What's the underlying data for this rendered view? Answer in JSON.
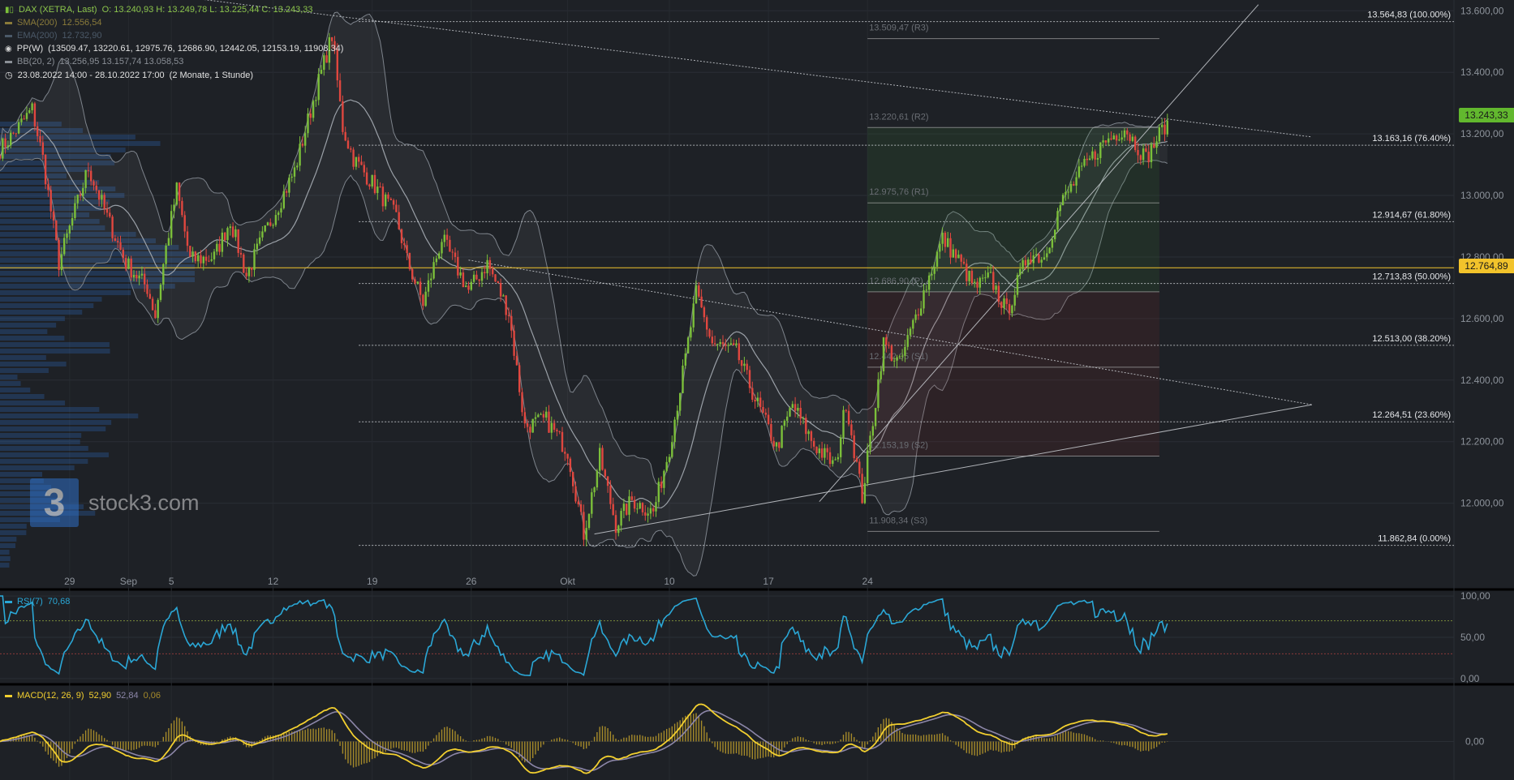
{
  "header": {
    "title": "DAX (XETRA, Last)",
    "ohlc": "O: 13.240,93  H: 13.249,78  L: 13.225,44  C: 13.243,33",
    "sma_label": "SMA(200)",
    "sma_value": "12.556,54",
    "ema_label": "EMA(200)",
    "ema_value": "12.732,90",
    "pp_label": "PP(W)",
    "pp_values": "(13509.47, 13220.61, 12975.76, 12686.90, 12442.05, 12153.19, 11908.34)",
    "bb_label": "BB(20, 2)",
    "bb_values": "13.256,95  13.157,74  13.058,53",
    "range_label": "23.08.2022 14:00 - 28.10.2022 17:00",
    "range_span": "(2 Monate, 1 Stunde)"
  },
  "logo": {
    "mark": "3",
    "text": "stock3.com"
  },
  "colors": {
    "background": "#1e2126",
    "up": "#7bbf3a",
    "down": "#e0473f",
    "price_tag": "#62b82e",
    "level_tag": "#f2c32b",
    "rsi": "#2aa7d6",
    "macd": "#f2cf2f",
    "signal": "#8c86a8",
    "histogram": "#a58a2a"
  },
  "price_tags": {
    "last": "13.243,33",
    "level": "12.764,89"
  },
  "chart_data": [
    {
      "type": "candlestick",
      "title": "DAX (XETRA, Last)",
      "x_ticks": [
        "29",
        "Sep",
        "5",
        "12",
        "19",
        "26",
        "Okt",
        "10",
        "17",
        "24"
      ],
      "y_ticks": [
        "13.600,00",
        "13.400,00",
        "13.200,00",
        "13.000,00",
        "12.800,00",
        "12.600,00",
        "12.400,00",
        "12.200,00",
        "12.000,00"
      ],
      "y_tick_values": [
        13600,
        13400,
        13200,
        13000,
        12800,
        12600,
        12400,
        12200,
        12000
      ],
      "ylim": [
        11725,
        13635
      ],
      "last": 13243.33,
      "horizontal_level": 12764.89,
      "path_anchors": [
        [
          0,
          13150
        ],
        [
          5,
          13200
        ],
        [
          12,
          13280
        ],
        [
          16,
          13120
        ],
        [
          22,
          12780
        ],
        [
          28,
          12950
        ],
        [
          33,
          13090
        ],
        [
          40,
          12930
        ],
        [
          47,
          12780
        ],
        [
          55,
          12700
        ],
        [
          58,
          12610
        ],
        [
          62,
          12830
        ],
        [
          66,
          13020
        ],
        [
          71,
          12790
        ],
        [
          80,
          12800
        ],
        [
          86,
          12920
        ],
        [
          92,
          12740
        ],
        [
          98,
          12860
        ],
        [
          110,
          13080
        ],
        [
          118,
          13340
        ],
        [
          124,
          13520
        ],
        [
          128,
          13220
        ],
        [
          132,
          13120
        ],
        [
          140,
          13030
        ],
        [
          148,
          12930
        ],
        [
          152,
          12790
        ],
        [
          158,
          12650
        ],
        [
          165,
          12860
        ],
        [
          175,
          12690
        ],
        [
          182,
          12780
        ],
        [
          190,
          12620
        ],
        [
          196,
          12250
        ],
        [
          204,
          12270
        ],
        [
          212,
          12170
        ],
        [
          218,
          11900
        ],
        [
          224,
          12150
        ],
        [
          230,
          11930
        ],
        [
          236,
          12010
        ],
        [
          244,
          11970
        ],
        [
          250,
          12180
        ],
        [
          256,
          12470
        ],
        [
          260,
          12680
        ],
        [
          266,
          12520
        ],
        [
          275,
          12490
        ],
        [
          282,
          12340
        ],
        [
          290,
          12180
        ],
        [
          296,
          12320
        ],
        [
          304,
          12190
        ],
        [
          312,
          12120
        ],
        [
          316,
          12330
        ],
        [
          322,
          12020
        ],
        [
          330,
          12520
        ],
        [
          336,
          12450
        ],
        [
          344,
          12660
        ],
        [
          352,
          12860
        ],
        [
          358,
          12790
        ],
        [
          364,
          12700
        ],
        [
          370,
          12730
        ],
        [
          376,
          12620
        ],
        [
          384,
          12810
        ],
        [
          390,
          12800
        ],
        [
          396,
          12970
        ],
        [
          404,
          13080
        ],
        [
          412,
          13170
        ],
        [
          420,
          13220
        ],
        [
          428,
          13120
        ],
        [
          436,
          13243
        ]
      ],
      "overlays": {
        "bollinger_bands": "BB(20, 2)",
        "pivot_points": [
          {
            "label": "13.509,47 (R3)",
            "value": 13509.47
          },
          {
            "label": "13.220,61 (R2)",
            "value": 13220.61
          },
          {
            "label": "12.975,76 (R1)",
            "value": 12975.76
          },
          {
            "label": "12.686,90 (P)",
            "value": 12686.9
          },
          {
            "label": "12.442,05 (S1)",
            "value": 12442.05
          },
          {
            "label": "12.153,19 (S2)",
            "value": 12153.19
          },
          {
            "label": "11.908,34 (S3)",
            "value": 11908.34
          }
        ],
        "fibonacci_levels": [
          {
            "label": "13.564,83 (100.00%)",
            "value": 13564.83
          },
          {
            "label": "13.163,16 (76.40%)",
            "value": 13163.16
          },
          {
            "label": "12.914,67 (61.80%)",
            "value": 12914.67
          },
          {
            "label": "12.713,83 (50.00%)",
            "value": 12713.83
          },
          {
            "label": "12.513,00 (38.20%)",
            "value": 12513.0
          },
          {
            "label": "12.264,51 (23.60%)",
            "value": 12264.51
          },
          {
            "label": "11.862,84 (0.00%)",
            "value": 11862.84
          }
        ],
        "trendlines": [
          {
            "from": [
              -20,
              13740
            ],
            "to": [
              490,
              13190
            ]
          },
          {
            "from": [
              175,
              12790
            ],
            "to": [
              490,
              12320
            ]
          },
          {
            "from": [
              222,
              11900
            ],
            "to": [
              490,
              12320
            ]
          },
          {
            "from": [
              306,
              12005
            ],
            "to": [
              470,
              13620
            ]
          }
        ]
      }
    },
    {
      "type": "line",
      "title": "RSI(7)",
      "value_label": "70,68",
      "y_ticks": [
        "100,00",
        "50,00",
        "0,00"
      ],
      "ylim": [
        -5,
        105
      ],
      "overbought": 70,
      "oversold": 30
    },
    {
      "type": "line",
      "title": "MACD(12, 26, 9)",
      "value_label": "52,90",
      "signal_label": "52,84",
      "hist_label": "0,06",
      "y_ticks": [
        "0,00"
      ]
    }
  ]
}
